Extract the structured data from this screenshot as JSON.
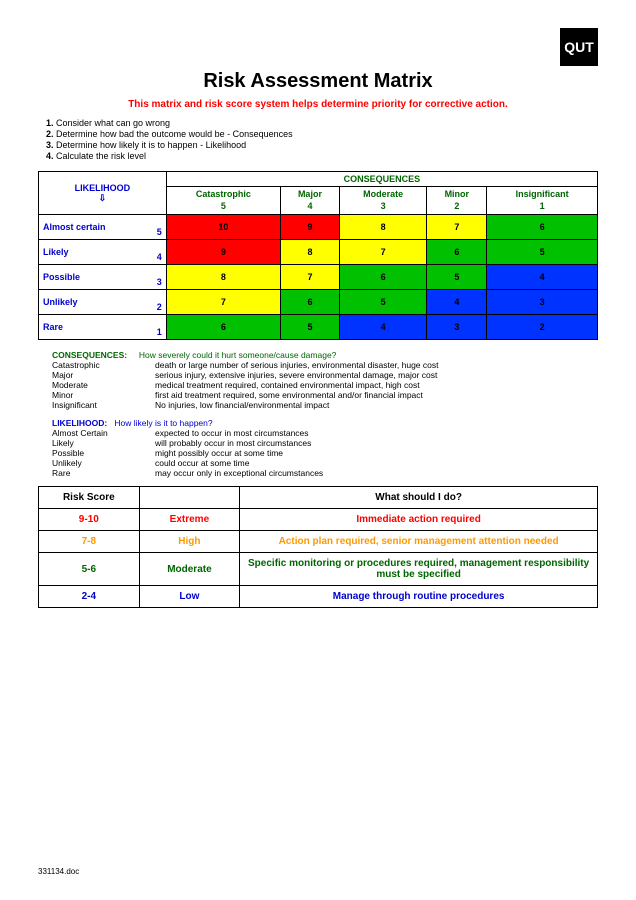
{
  "logo_text": "QUT",
  "title": "Risk Assessment Matrix",
  "subtitle": "This matrix and risk score system helps determine priority for corrective action.",
  "steps": [
    "Consider what can go wrong",
    "Determine how bad the outcome would be - Consequences",
    "Determine how likely it is to happen - Likelihood",
    "Calculate the risk level"
  ],
  "matrix": {
    "likelihood_label": "LIKELIHOOD",
    "consequences_label": "CONSEQUENCES",
    "columns": [
      {
        "name": "Catastrophic",
        "num": "5"
      },
      {
        "name": "Major",
        "num": "4"
      },
      {
        "name": "Moderate",
        "num": "3"
      },
      {
        "name": "Minor",
        "num": "2"
      },
      {
        "name": "Insignificant",
        "num": "1"
      }
    ],
    "rows": [
      {
        "name": "Almost certain",
        "num": "5",
        "cells": [
          {
            "v": "10",
            "c": "red"
          },
          {
            "v": "9",
            "c": "red"
          },
          {
            "v": "8",
            "c": "yellow"
          },
          {
            "v": "7",
            "c": "yellow"
          },
          {
            "v": "6",
            "c": "green"
          }
        ]
      },
      {
        "name": "Likely",
        "num": "4",
        "cells": [
          {
            "v": "9",
            "c": "red"
          },
          {
            "v": "8",
            "c": "yellow"
          },
          {
            "v": "7",
            "c": "yellow"
          },
          {
            "v": "6",
            "c": "green"
          },
          {
            "v": "5",
            "c": "green"
          }
        ]
      },
      {
        "name": "Possible",
        "num": "3",
        "cells": [
          {
            "v": "8",
            "c": "yellow"
          },
          {
            "v": "7",
            "c": "yellow"
          },
          {
            "v": "6",
            "c": "green"
          },
          {
            "v": "5",
            "c": "green"
          },
          {
            "v": "4",
            "c": "blue"
          }
        ]
      },
      {
        "name": "Unlikely",
        "num": "2",
        "cells": [
          {
            "v": "7",
            "c": "yellow"
          },
          {
            "v": "6",
            "c": "green"
          },
          {
            "v": "5",
            "c": "green"
          },
          {
            "v": "4",
            "c": "blue"
          },
          {
            "v": "3",
            "c": "blue"
          }
        ]
      },
      {
        "name": "Rare",
        "num": "1",
        "cells": [
          {
            "v": "6",
            "c": "green"
          },
          {
            "v": "5",
            "c": "green"
          },
          {
            "v": "4",
            "c": "blue"
          },
          {
            "v": "3",
            "c": "blue"
          },
          {
            "v": "2",
            "c": "blue"
          }
        ]
      }
    ]
  },
  "conseq_defs": {
    "title": "CONSEQUENCES:",
    "question": "How severely could it hurt someone/cause damage?",
    "items": [
      {
        "t": "Catastrophic",
        "d": "death or large number of serious injuries, environmental disaster,    huge cost"
      },
      {
        "t": "Major",
        "d": "serious injury, extensive injuries, severe environmental damage, major cost"
      },
      {
        "t": "Moderate",
        "d": "medical treatment required, contained environmental impact, high cost"
      },
      {
        "t": "Minor",
        "d": "first aid treatment required, some environmental and/or financial impact"
      },
      {
        "t": "Insignificant",
        "d": "No injuries, low financial/environmental impact"
      }
    ]
  },
  "likelihood_defs": {
    "title": "LIKELIHOOD:",
    "question": "How likely is it to happen?",
    "items": [
      {
        "t": "Almost Certain",
        "d": "expected to occur in most circumstances"
      },
      {
        "t": "Likely",
        "d": "will probably occur in most circumstances"
      },
      {
        "t": "Possible",
        "d": "might possibly occur at some time"
      },
      {
        "t": "Unlikely",
        "d": "could occur at some time"
      },
      {
        "t": "Rare",
        "d": "may occur only in exceptional circumstances"
      }
    ]
  },
  "actions": {
    "header_score": "Risk Score",
    "header_action": "What should I do?",
    "rows": [
      {
        "score": "9-10",
        "level": "Extreme",
        "action": "Immediate action required",
        "cls": "a-extreme"
      },
      {
        "score": "7-8",
        "level": "High",
        "action": "Action plan required, senior management attention needed",
        "cls": "a-high"
      },
      {
        "score": "5-6",
        "level": "Moderate",
        "action": "Specific monitoring or procedures required, management responsibility must be specified",
        "cls": "a-moderate"
      },
      {
        "score": "2-4",
        "level": "Low",
        "action": "Manage through routine procedures",
        "cls": "a-low"
      }
    ]
  },
  "footer": "331134.doc",
  "chart_data": {
    "type": "heatmap",
    "title": "Risk Assessment Matrix",
    "xlabel": "CONSEQUENCES",
    "ylabel": "LIKELIHOOD",
    "x_categories": [
      "Catastrophic 5",
      "Major 4",
      "Moderate 3",
      "Minor 2",
      "Insignificant 1"
    ],
    "y_categories": [
      "Almost certain 5",
      "Likely 4",
      "Possible 3",
      "Unlikely 2",
      "Rare 1"
    ],
    "values": [
      [
        10,
        9,
        8,
        7,
        6
      ],
      [
        9,
        8,
        7,
        6,
        5
      ],
      [
        8,
        7,
        6,
        5,
        4
      ],
      [
        7,
        6,
        5,
        4,
        3
      ],
      [
        6,
        5,
        4,
        3,
        2
      ]
    ],
    "color_scale": {
      "2": "blue",
      "3": "blue",
      "4": "blue",
      "5": "green",
      "6": "green",
      "7": "yellow",
      "8": "yellow",
      "9": "red",
      "10": "red"
    }
  }
}
